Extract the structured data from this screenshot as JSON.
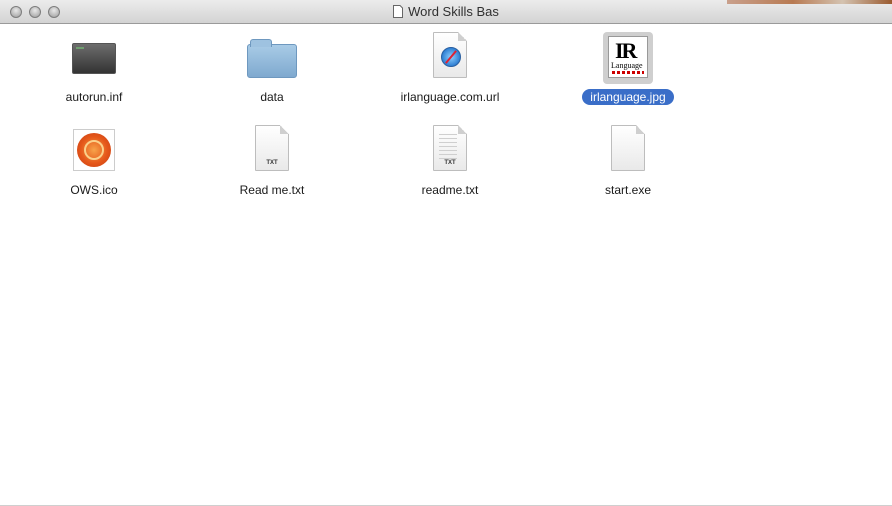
{
  "window": {
    "title": "Word Skills Bas"
  },
  "files": [
    {
      "name": "autorun.inf",
      "kind": "terminal-icon",
      "selected": false
    },
    {
      "name": "data",
      "kind": "folder-icon",
      "selected": false
    },
    {
      "name": "irlanguage.com.url",
      "kind": "safari-url-icon",
      "selected": false
    },
    {
      "name": "irlanguage.jpg",
      "kind": "image-preview-icon",
      "selected": true,
      "preview": {
        "letters": "IR",
        "subtitle": "Language"
      }
    },
    {
      "name": "OWS.ico",
      "kind": "ico-icon",
      "selected": false
    },
    {
      "name": "Read me.txt",
      "kind": "txt-file-icon",
      "selected": false,
      "badge": "TXT"
    },
    {
      "name": "readme.txt",
      "kind": "txt-file-icon",
      "selected": false,
      "badge": "TXT"
    },
    {
      "name": "start.exe",
      "kind": "blank-file-icon",
      "selected": false
    }
  ],
  "colors": {
    "selection": "#3a6ec8"
  }
}
